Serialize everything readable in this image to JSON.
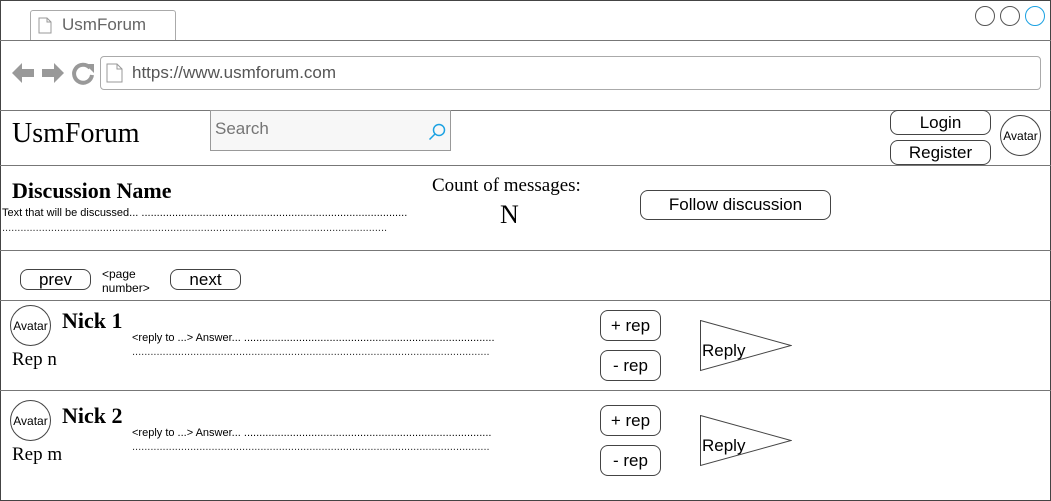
{
  "browser": {
    "tab_title": "UsmForum",
    "url": "https://www.usmforum.com"
  },
  "header": {
    "logo": "UsmForum",
    "search_placeholder": "Search",
    "login_label": "Login",
    "register_label": "Register",
    "avatar_label": "Avatar"
  },
  "discussion": {
    "title": "Discussion Name",
    "text": "Text that will be discussed... .......................................................................................",
    "text_line2": "..............................................................................................................................",
    "count_label": "Count of messages:",
    "count_value": "N",
    "follow_label": "Follow discussion"
  },
  "pagination": {
    "prev_label": "prev",
    "page_label": "<page number>",
    "page_line1": "<page",
    "page_line2": "number>",
    "next_label": "next"
  },
  "messages": [
    {
      "avatar_label": "Avatar",
      "nick": "Nick 1",
      "rep": "Rep n",
      "answer": "<reply to ...> Answer... ..................................................................................",
      "answer_line2": ".....................................................................................................................",
      "plus_label": "+ rep",
      "minus_label": "- rep",
      "reply_label": "Reply"
    },
    {
      "avatar_label": "Avatar",
      "nick": "Nick 2",
      "rep": "Rep m",
      "answer": "<reply to ...> Answer... .................................................................................",
      "answer_line2": ".....................................................................................................................",
      "plus_label": "+ rep",
      "minus_label": "- rep",
      "reply_label": "Reply"
    }
  ]
}
